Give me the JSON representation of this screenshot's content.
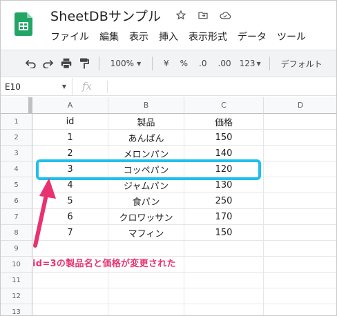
{
  "doc": {
    "title": "SheetDBサンプル"
  },
  "menu": [
    "ファイル",
    "編集",
    "表示",
    "挿入",
    "表示形式",
    "データ",
    "ツール"
  ],
  "toolbar": {
    "zoom": "100%",
    "currency": "¥",
    "percent": "%",
    "dec_decrease": ".0",
    "dec_increase": ".00",
    "format_more": "123",
    "font": "デフォルト"
  },
  "formula_bar": {
    "name_box": "E10",
    "fx_label": "fx"
  },
  "sheet": {
    "columns": [
      "A",
      "B",
      "C",
      "D"
    ],
    "row_numbers": [
      "1",
      "2",
      "3",
      "4",
      "5",
      "6",
      "7",
      "8",
      "9",
      "10",
      "11",
      "12",
      "13"
    ],
    "rows": [
      [
        "id",
        "製品",
        "価格"
      ],
      [
        "1",
        "あんぱん",
        "150"
      ],
      [
        "2",
        "メロンパン",
        "140"
      ],
      [
        "3",
        "コッペパン",
        "120"
      ],
      [
        "4",
        "ジャムパン",
        "130"
      ],
      [
        "5",
        "食パン",
        "250"
      ],
      [
        "6",
        "クロワッサン",
        "170"
      ],
      [
        "7",
        "マフィン",
        "150"
      ]
    ]
  },
  "annotation": {
    "text": "id=3の製品名と価格が変更された",
    "color": "#e8336f",
    "highlight_color": "#1ec0ee"
  }
}
